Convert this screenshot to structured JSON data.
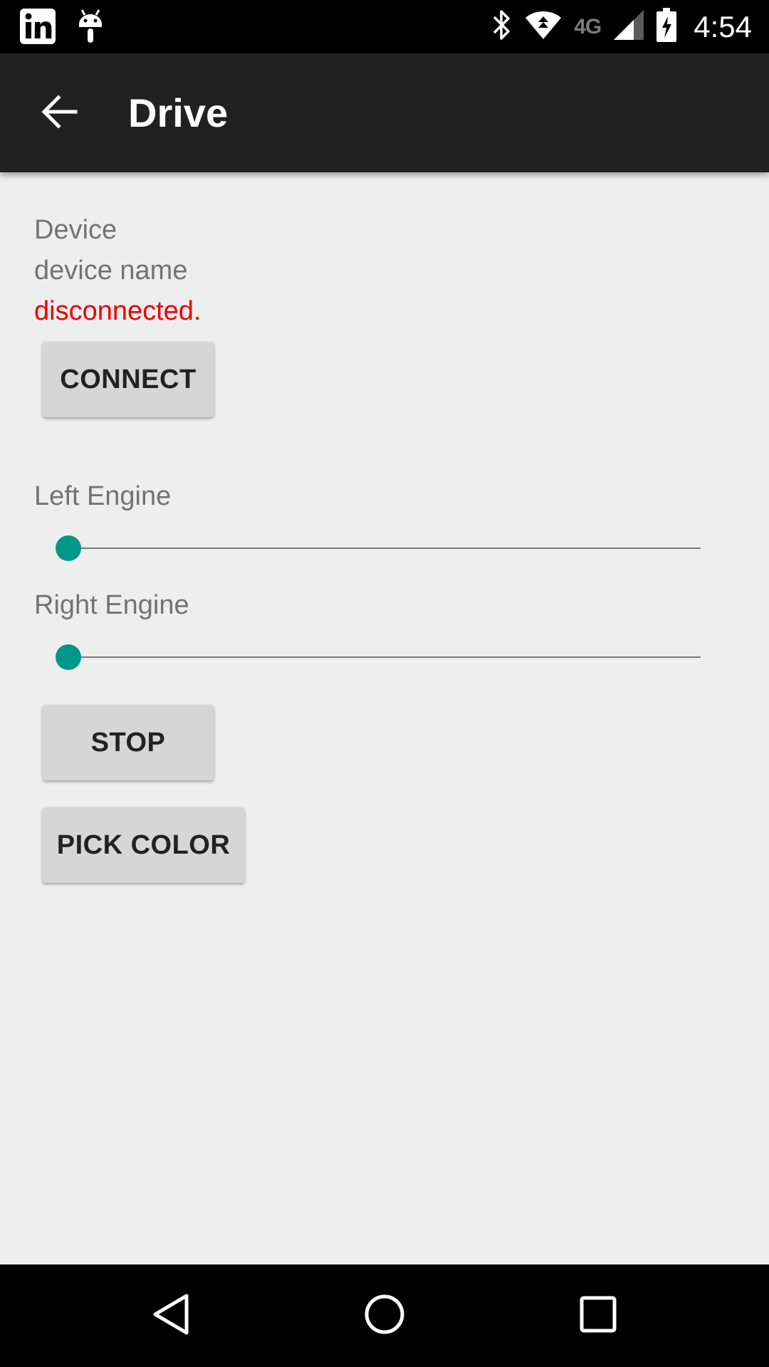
{
  "status_bar": {
    "time": "4:54",
    "network_type": "4G",
    "icons": [
      "linkedin-icon",
      "android-debug-icon",
      "bluetooth-icon",
      "wifi-icon",
      "signal-icon",
      "battery-charging-icon"
    ]
  },
  "app_bar": {
    "title": "Drive",
    "back_icon": "arrow-back-icon"
  },
  "device": {
    "label": "Device",
    "name": "device name",
    "status": "disconnected.",
    "status_color": "#ee0000"
  },
  "buttons": {
    "connect": "CONNECT",
    "stop": "STOP",
    "pick_color": "PICK COLOR"
  },
  "sliders": {
    "left_engine": {
      "label": "Left Engine",
      "value": 0
    },
    "right_engine": {
      "label": "Right Engine",
      "value": 0
    }
  },
  "colors": {
    "accent": "#009688",
    "app_bar": "#212121",
    "background": "#eeeeee"
  },
  "nav_bar": {
    "icons": [
      "back-triangle-icon",
      "home-circle-icon",
      "recents-square-icon"
    ]
  }
}
